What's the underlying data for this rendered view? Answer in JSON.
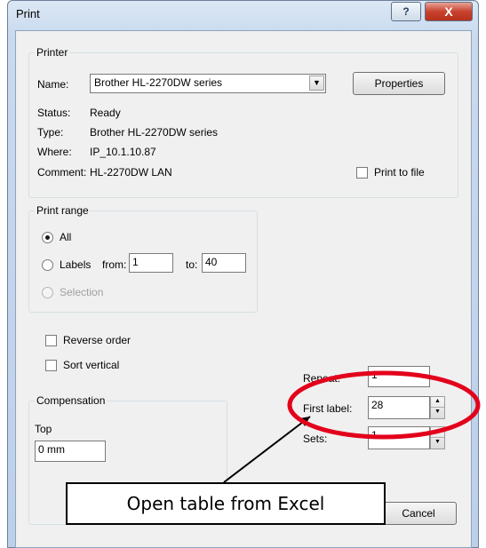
{
  "window": {
    "title": "Print",
    "help_glyph": "?",
    "close_glyph": "X"
  },
  "printer": {
    "group_label": "Printer",
    "name_label": "Name:",
    "name_value": "Brother HL-2270DW series",
    "properties_label": "Properties",
    "status_label": "Status:",
    "status_value": "Ready",
    "type_label": "Type:",
    "type_value": "Brother HL-2270DW series",
    "where_label": "Where:",
    "where_value": "IP_10.1.10.87",
    "comment_label": "Comment:",
    "comment_value": "HL-2270DW LAN",
    "print_to_file_label": "Print to file"
  },
  "print_range": {
    "group_label": "Print range",
    "all_label": "All",
    "labels_label": "Labels",
    "from_label": "from:",
    "from_value": "1",
    "to_label": "to:",
    "to_value": "40",
    "selection_label": "Selection"
  },
  "options": {
    "reverse_order_label": "Reverse order",
    "sort_vertical_label": "Sort vertical"
  },
  "compensation": {
    "group_label": "Compensation",
    "top_label": "Top",
    "top_value": "0 mm"
  },
  "copies": {
    "repeat_label": "Repeat:",
    "repeat_value": "1",
    "first_label_label": "First label:",
    "first_label_value": "28",
    "sets_label": "Sets:",
    "sets_value": "1"
  },
  "buttons": {
    "cancel_label": "Cancel"
  },
  "annotation": {
    "callout_text": "Open table from Excel",
    "ellipse_color": "#e3001b",
    "arrow_color": "#000000"
  }
}
